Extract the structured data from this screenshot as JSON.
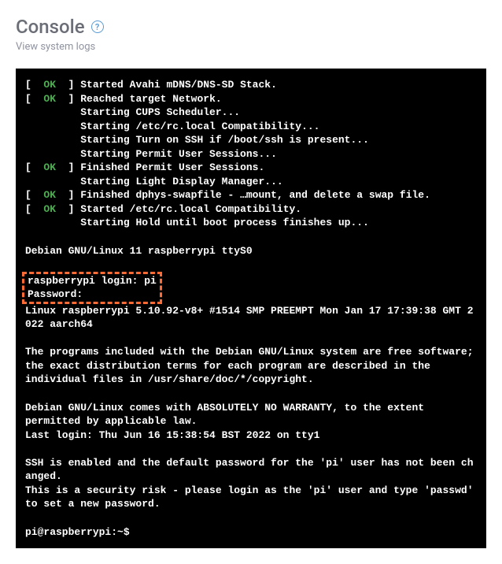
{
  "header": {
    "title": "Console",
    "help_glyph": "?",
    "subtitle": "View system logs"
  },
  "boot_lines": [
    {
      "status": "OK",
      "action": "Started",
      "bold": "Avahi mDNS/DNS-SD Stack",
      "suffix": "."
    },
    {
      "status": "OK",
      "action": "Reached target",
      "bold": "Network",
      "suffix": "."
    },
    {
      "status": null,
      "action": "Starting",
      "bold": "CUPS Scheduler",
      "suffix": "..."
    },
    {
      "status": null,
      "action": "Starting",
      "bold": "/etc/rc.local Compatibility",
      "suffix": "..."
    },
    {
      "status": null,
      "action": "Starting",
      "bold": "Turn on SSH if /boot/ssh is present",
      "suffix": "..."
    },
    {
      "status": null,
      "action": "Starting",
      "bold": "Permit User Sessions",
      "suffix": "..."
    },
    {
      "status": "OK",
      "action": "Finished",
      "bold": "Permit User Sessions",
      "suffix": "."
    },
    {
      "status": null,
      "action": "Starting",
      "bold": "Light Display Manager",
      "suffix": "..."
    },
    {
      "status": "OK",
      "action": "Finished",
      "bold": "dphys-swapfile - …mount, and delete a swap file",
      "suffix": "."
    },
    {
      "status": "OK",
      "action": "Started",
      "bold": "/etc/rc.local Compatibility",
      "suffix": "."
    },
    {
      "status": null,
      "action": "Starting",
      "bold": "Hold until boot process finishes up",
      "suffix": "..."
    }
  ],
  "banner": {
    "os_line": "Debian GNU/Linux 11 raspberrypi ttyS0",
    "login_line": "raspberrypi login: pi",
    "password_label": "Password:",
    "kernel_line": "Linux raspberrypi 5.10.92-v8+ #1514 SMP PREEMPT Mon Jan 17 17:39:38 GMT 2022 aarch64",
    "para1": "The programs included with the Debian GNU/Linux system are free software;\nthe exact distribution terms for each program are described in the\nindividual files in /usr/share/doc/*/copyright.",
    "para2": "Debian GNU/Linux comes with ABSOLUTELY NO WARRANTY, to the extent\npermitted by applicable law.",
    "last_login": "Last login: Thu Jun 16 15:38:54 BST 2022 on tty1",
    "ssh_warn1": "SSH is enabled and the default password for the 'pi' user has not been changed.",
    "ssh_warn2": "This is a security risk - please login as the 'pi' user and type 'passwd' to set a new password.",
    "prompt": "pi@raspberrypi:~$"
  }
}
